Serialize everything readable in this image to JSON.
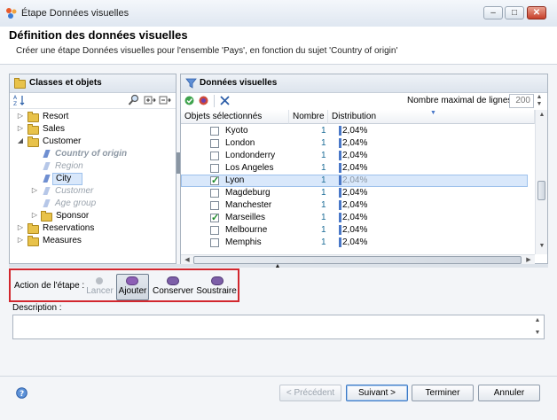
{
  "window": {
    "title": "Étape Données visuelles"
  },
  "header": {
    "title": "Définition des données visuelles",
    "subtitle": "Créer une étape Données visuelles pour l'ensemble 'Pays', en fonction du sujet 'Country of origin'"
  },
  "left_panel": {
    "title": "Classes et objets",
    "tree": [
      {
        "label": "Resort",
        "level": 0,
        "type": "folder",
        "toggle": "▷"
      },
      {
        "label": "Sales",
        "level": 0,
        "type": "folder",
        "toggle": "▷"
      },
      {
        "label": "Customer",
        "level": 0,
        "type": "folder",
        "toggle": "◢"
      },
      {
        "label": "Country of origin",
        "level": 1,
        "type": "dimension-active",
        "toggle": ""
      },
      {
        "label": "Region",
        "level": 1,
        "type": "dimension-dim",
        "toggle": ""
      },
      {
        "label": "City",
        "level": 1,
        "type": "dimension-selected",
        "toggle": ""
      },
      {
        "label": "Customer",
        "level": 1,
        "type": "dimension-dim",
        "toggle": "▷"
      },
      {
        "label": "Age group",
        "level": 1,
        "type": "dimension-dim",
        "toggle": ""
      },
      {
        "label": "Sponsor",
        "level": 1,
        "type": "folder",
        "toggle": "▷"
      },
      {
        "label": "Reservations",
        "level": 0,
        "type": "folder",
        "toggle": "▷"
      },
      {
        "label": "Measures",
        "level": 0,
        "type": "folder",
        "toggle": "▷"
      }
    ]
  },
  "right_panel": {
    "title": "Données visuelles",
    "max_rows_label": "Nombre maximal de lignes",
    "max_rows_value": "200",
    "columns": {
      "objects": "Objets sélectionnés",
      "count": "Nombre",
      "distribution": "Distribution"
    },
    "rows": [
      {
        "name": "Kyoto",
        "count": "1",
        "dist": "2,04%",
        "checked": false,
        "selected": false
      },
      {
        "name": "London",
        "count": "1",
        "dist": "2,04%",
        "checked": false,
        "selected": false
      },
      {
        "name": "Londonderry",
        "count": "1",
        "dist": "2,04%",
        "checked": false,
        "selected": false
      },
      {
        "name": "Los Angeles",
        "count": "1",
        "dist": "2,04%",
        "checked": false,
        "selected": false
      },
      {
        "name": "Lyon",
        "count": "1",
        "dist": "2,04%",
        "checked": true,
        "selected": true
      },
      {
        "name": "Magdeburg",
        "count": "1",
        "dist": "2,04%",
        "checked": false,
        "selected": false
      },
      {
        "name": "Manchester",
        "count": "1",
        "dist": "2,04%",
        "checked": false,
        "selected": false
      },
      {
        "name": "Marseilles",
        "count": "1",
        "dist": "2,04%",
        "checked": true,
        "selected": false
      },
      {
        "name": "Melbourne",
        "count": "1",
        "dist": "2,04%",
        "checked": false,
        "selected": false
      },
      {
        "name": "Memphis",
        "count": "1",
        "dist": "2,04%",
        "checked": false,
        "selected": false
      }
    ]
  },
  "actions": {
    "label": "Action de l'étape :",
    "buttons": [
      {
        "label": "Lancer",
        "state": "disabled",
        "icon_color": "#b9bec5"
      },
      {
        "label": "Ajouter",
        "state": "pressed",
        "icon_color": "#8d5fb5"
      },
      {
        "label": "Conserver",
        "state": "normal",
        "icon_color": "#7d5fa8"
      },
      {
        "label": "Soustraire",
        "state": "normal",
        "icon_color": "#7d5fa8"
      }
    ]
  },
  "description": {
    "label": "Description :",
    "value": ""
  },
  "footer": {
    "previous": "< Précédent",
    "next": "Suivant >",
    "finish": "Terminer",
    "cancel": "Annuler"
  },
  "colors": {
    "accent": "#3b79c5",
    "highlight_border": "#d2272e",
    "selection": "#d9e8fb"
  }
}
